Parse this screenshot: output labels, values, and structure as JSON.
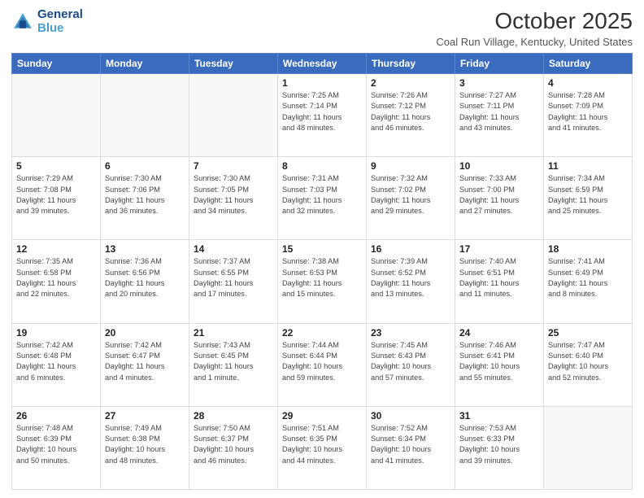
{
  "header": {
    "logo_line1": "General",
    "logo_line2": "Blue",
    "month": "October 2025",
    "location": "Coal Run Village, Kentucky, United States"
  },
  "weekdays": [
    "Sunday",
    "Monday",
    "Tuesday",
    "Wednesday",
    "Thursday",
    "Friday",
    "Saturday"
  ],
  "weeks": [
    [
      {
        "day": "",
        "info": ""
      },
      {
        "day": "",
        "info": ""
      },
      {
        "day": "",
        "info": ""
      },
      {
        "day": "1",
        "info": "Sunrise: 7:25 AM\nSunset: 7:14 PM\nDaylight: 11 hours\nand 48 minutes."
      },
      {
        "day": "2",
        "info": "Sunrise: 7:26 AM\nSunset: 7:12 PM\nDaylight: 11 hours\nand 46 minutes."
      },
      {
        "day": "3",
        "info": "Sunrise: 7:27 AM\nSunset: 7:11 PM\nDaylight: 11 hours\nand 43 minutes."
      },
      {
        "day": "4",
        "info": "Sunrise: 7:28 AM\nSunset: 7:09 PM\nDaylight: 11 hours\nand 41 minutes."
      }
    ],
    [
      {
        "day": "5",
        "info": "Sunrise: 7:29 AM\nSunset: 7:08 PM\nDaylight: 11 hours\nand 39 minutes."
      },
      {
        "day": "6",
        "info": "Sunrise: 7:30 AM\nSunset: 7:06 PM\nDaylight: 11 hours\nand 36 minutes."
      },
      {
        "day": "7",
        "info": "Sunrise: 7:30 AM\nSunset: 7:05 PM\nDaylight: 11 hours\nand 34 minutes."
      },
      {
        "day": "8",
        "info": "Sunrise: 7:31 AM\nSunset: 7:03 PM\nDaylight: 11 hours\nand 32 minutes."
      },
      {
        "day": "9",
        "info": "Sunrise: 7:32 AM\nSunset: 7:02 PM\nDaylight: 11 hours\nand 29 minutes."
      },
      {
        "day": "10",
        "info": "Sunrise: 7:33 AM\nSunset: 7:00 PM\nDaylight: 11 hours\nand 27 minutes."
      },
      {
        "day": "11",
        "info": "Sunrise: 7:34 AM\nSunset: 6:59 PM\nDaylight: 11 hours\nand 25 minutes."
      }
    ],
    [
      {
        "day": "12",
        "info": "Sunrise: 7:35 AM\nSunset: 6:58 PM\nDaylight: 11 hours\nand 22 minutes."
      },
      {
        "day": "13",
        "info": "Sunrise: 7:36 AM\nSunset: 6:56 PM\nDaylight: 11 hours\nand 20 minutes."
      },
      {
        "day": "14",
        "info": "Sunrise: 7:37 AM\nSunset: 6:55 PM\nDaylight: 11 hours\nand 17 minutes."
      },
      {
        "day": "15",
        "info": "Sunrise: 7:38 AM\nSunset: 6:53 PM\nDaylight: 11 hours\nand 15 minutes."
      },
      {
        "day": "16",
        "info": "Sunrise: 7:39 AM\nSunset: 6:52 PM\nDaylight: 11 hours\nand 13 minutes."
      },
      {
        "day": "17",
        "info": "Sunrise: 7:40 AM\nSunset: 6:51 PM\nDaylight: 11 hours\nand 11 minutes."
      },
      {
        "day": "18",
        "info": "Sunrise: 7:41 AM\nSunset: 6:49 PM\nDaylight: 11 hours\nand 8 minutes."
      }
    ],
    [
      {
        "day": "19",
        "info": "Sunrise: 7:42 AM\nSunset: 6:48 PM\nDaylight: 11 hours\nand 6 minutes."
      },
      {
        "day": "20",
        "info": "Sunrise: 7:42 AM\nSunset: 6:47 PM\nDaylight: 11 hours\nand 4 minutes."
      },
      {
        "day": "21",
        "info": "Sunrise: 7:43 AM\nSunset: 6:45 PM\nDaylight: 11 hours\nand 1 minute."
      },
      {
        "day": "22",
        "info": "Sunrise: 7:44 AM\nSunset: 6:44 PM\nDaylight: 10 hours\nand 59 minutes."
      },
      {
        "day": "23",
        "info": "Sunrise: 7:45 AM\nSunset: 6:43 PM\nDaylight: 10 hours\nand 57 minutes."
      },
      {
        "day": "24",
        "info": "Sunrise: 7:46 AM\nSunset: 6:41 PM\nDaylight: 10 hours\nand 55 minutes."
      },
      {
        "day": "25",
        "info": "Sunrise: 7:47 AM\nSunset: 6:40 PM\nDaylight: 10 hours\nand 52 minutes."
      }
    ],
    [
      {
        "day": "26",
        "info": "Sunrise: 7:48 AM\nSunset: 6:39 PM\nDaylight: 10 hours\nand 50 minutes."
      },
      {
        "day": "27",
        "info": "Sunrise: 7:49 AM\nSunset: 6:38 PM\nDaylight: 10 hours\nand 48 minutes."
      },
      {
        "day": "28",
        "info": "Sunrise: 7:50 AM\nSunset: 6:37 PM\nDaylight: 10 hours\nand 46 minutes."
      },
      {
        "day": "29",
        "info": "Sunrise: 7:51 AM\nSunset: 6:35 PM\nDaylight: 10 hours\nand 44 minutes."
      },
      {
        "day": "30",
        "info": "Sunrise: 7:52 AM\nSunset: 6:34 PM\nDaylight: 10 hours\nand 41 minutes."
      },
      {
        "day": "31",
        "info": "Sunrise: 7:53 AM\nSunset: 6:33 PM\nDaylight: 10 hours\nand 39 minutes."
      },
      {
        "day": "",
        "info": ""
      }
    ]
  ]
}
